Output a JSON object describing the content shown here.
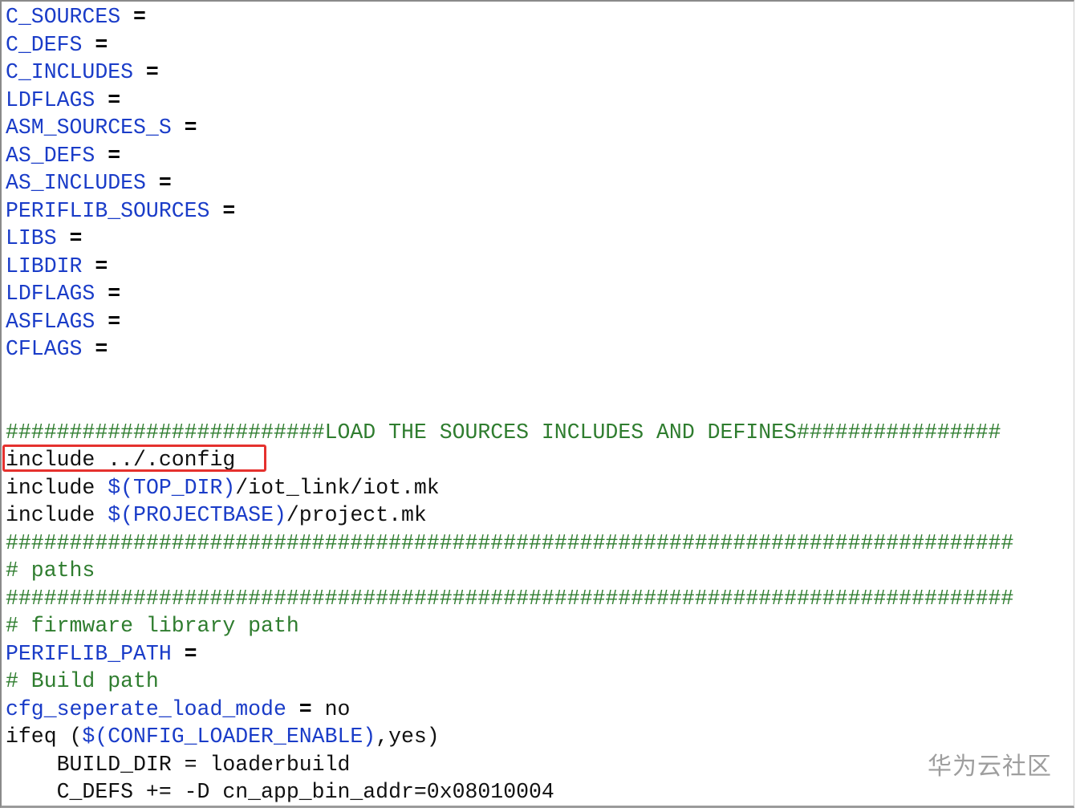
{
  "lines": [
    {
      "parts": [
        {
          "cls": "var",
          "text": "C_SOURCES"
        },
        {
          "cls": "op",
          "text": " ="
        }
      ]
    },
    {
      "parts": [
        {
          "cls": "var",
          "text": "C_DEFS"
        },
        {
          "cls": "op",
          "text": " ="
        }
      ]
    },
    {
      "parts": [
        {
          "cls": "var",
          "text": "C_INCLUDES"
        },
        {
          "cls": "op",
          "text": " ="
        }
      ]
    },
    {
      "parts": [
        {
          "cls": "var",
          "text": "LDFLAGS"
        },
        {
          "cls": "op",
          "text": " ="
        }
      ]
    },
    {
      "parts": [
        {
          "cls": "var",
          "text": "ASM_SOURCES_S"
        },
        {
          "cls": "op",
          "text": " ="
        }
      ]
    },
    {
      "parts": [
        {
          "cls": "var",
          "text": "AS_DEFS"
        },
        {
          "cls": "op",
          "text": " ="
        }
      ]
    },
    {
      "parts": [
        {
          "cls": "var",
          "text": "AS_INCLUDES"
        },
        {
          "cls": "op",
          "text": " ="
        }
      ]
    },
    {
      "parts": [
        {
          "cls": "var",
          "text": "PERIFLIB_SOURCES"
        },
        {
          "cls": "op",
          "text": " ="
        }
      ]
    },
    {
      "parts": [
        {
          "cls": "var",
          "text": "LIBS"
        },
        {
          "cls": "op",
          "text": " ="
        }
      ]
    },
    {
      "parts": [
        {
          "cls": "var",
          "text": "LIBDIR"
        },
        {
          "cls": "op",
          "text": " ="
        }
      ]
    },
    {
      "parts": [
        {
          "cls": "var",
          "text": "LDFLAGS"
        },
        {
          "cls": "op",
          "text": " ="
        }
      ]
    },
    {
      "parts": [
        {
          "cls": "var",
          "text": "ASFLAGS"
        },
        {
          "cls": "op",
          "text": " ="
        }
      ]
    },
    {
      "parts": [
        {
          "cls": "var",
          "text": "CFLAGS"
        },
        {
          "cls": "op",
          "text": " ="
        }
      ]
    },
    {
      "parts": []
    },
    {
      "parts": []
    },
    {
      "parts": [
        {
          "cls": "cmt",
          "text": "#########################LOAD THE SOURCES INCLUDES AND DEFINES################"
        }
      ]
    },
    {
      "parts": [
        {
          "cls": "txt",
          "text": "include ../.config"
        }
      ]
    },
    {
      "parts": [
        {
          "cls": "txt",
          "text": "include "
        },
        {
          "cls": "var",
          "text": "$(TOP_DIR)"
        },
        {
          "cls": "txt",
          "text": "/iot_link/iot.mk"
        }
      ]
    },
    {
      "parts": [
        {
          "cls": "txt",
          "text": "include "
        },
        {
          "cls": "var",
          "text": "$(PROJECTBASE)"
        },
        {
          "cls": "txt",
          "text": "/project.mk"
        }
      ]
    },
    {
      "parts": [
        {
          "cls": "cmt",
          "text": "###############################################################################"
        }
      ]
    },
    {
      "parts": [
        {
          "cls": "cmt",
          "text": "# paths"
        }
      ]
    },
    {
      "parts": [
        {
          "cls": "cmt",
          "text": "###############################################################################"
        }
      ]
    },
    {
      "parts": [
        {
          "cls": "cmt",
          "text": "# firmware library path"
        }
      ]
    },
    {
      "parts": [
        {
          "cls": "var",
          "text": "PERIFLIB_PATH"
        },
        {
          "cls": "op",
          "text": " ="
        }
      ]
    },
    {
      "parts": [
        {
          "cls": "cmt",
          "text": "# Build path"
        }
      ]
    },
    {
      "parts": [
        {
          "cls": "var",
          "text": "cfg_seperate_load_mode"
        },
        {
          "cls": "op",
          "text": " ="
        },
        {
          "cls": "txt",
          "text": " no"
        }
      ]
    },
    {
      "parts": [
        {
          "cls": "txt",
          "text": "ifeq ("
        },
        {
          "cls": "var",
          "text": "$(CONFIG_LOADER_ENABLE)"
        },
        {
          "cls": "txt",
          "text": ",yes)"
        }
      ]
    },
    {
      "parts": [
        {
          "cls": "txt",
          "text": "    BUILD_DIR = loaderbuild"
        }
      ]
    },
    {
      "parts": [
        {
          "cls": "txt",
          "text": "    C_DEFS += -D cn_app_bin_addr=0x08010004"
        }
      ]
    }
  ],
  "watermark": "华为云社区",
  "colors": {
    "variable": "#1a3cc8",
    "comment": "#2f7d2f",
    "highlight_border": "#e5312e"
  }
}
